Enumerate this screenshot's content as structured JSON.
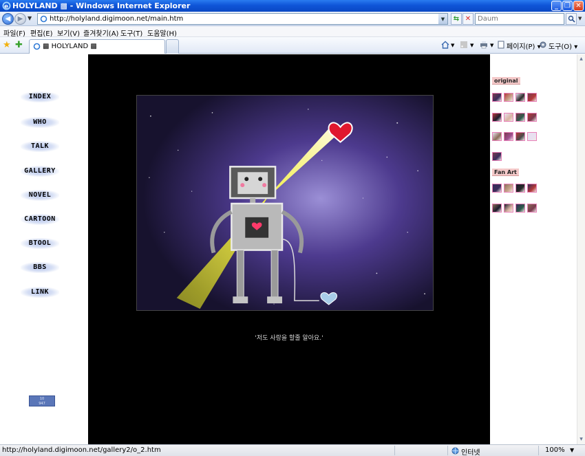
{
  "window": {
    "title": "HOLYLAND ▩ - Windows Internet Explorer",
    "minimize": "_",
    "restore": "❐",
    "close": "✕"
  },
  "address": {
    "url": "http://holyland.digimoon.net/main.htm",
    "search_placeholder": "Daum"
  },
  "menu": [
    "파일(F)",
    "편집(E)",
    "보기(V)",
    "즐겨찾기(A)",
    "도구(T)",
    "도움말(H)"
  ],
  "tab": {
    "label": "▩ HOLYLAND ▩"
  },
  "commands": {
    "page": "페이지(P) ▾",
    "tools": "도구(O) ▾"
  },
  "sidebar": {
    "items": [
      "INDEX",
      "WHO",
      "TALK",
      "GALLERY",
      "NOVEL",
      "CARTOON",
      "BTOOL",
      "BBS",
      "LINK"
    ],
    "counter": "10\n947"
  },
  "main": {
    "caption": "'저도 사랑을 할줄 알아요.'"
  },
  "gallery": {
    "original_label": "original",
    "fanart_label": "Fan Art",
    "original_count": 13,
    "fanart_count": 8
  },
  "status": {
    "link": "http://holyland.digimoon.net/gallery2/o_2.htm",
    "zone": "인터넷",
    "zoom": "100%"
  },
  "colors": {
    "titlebar": "#0f55d8",
    "main_bg": "#000000",
    "label_bg": "#f4c9c9"
  }
}
